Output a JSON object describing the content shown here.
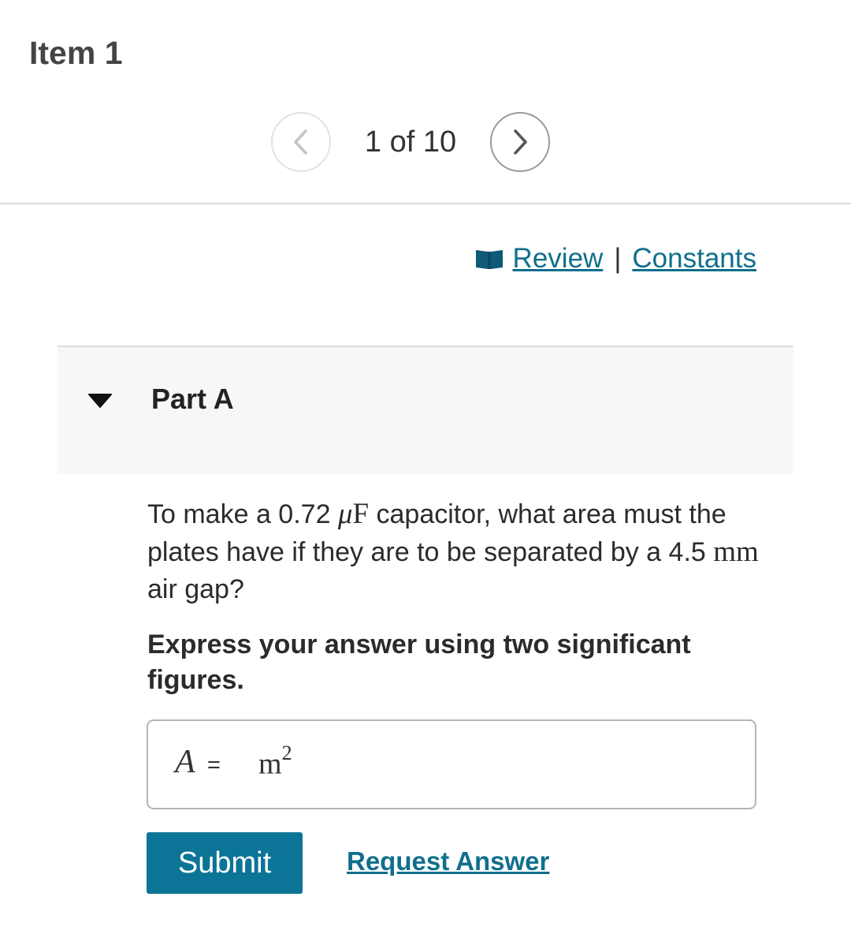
{
  "item": {
    "title": "Item 1"
  },
  "pager": {
    "position_label": "1 of 10",
    "prev_icon": "chevron-left-icon",
    "next_icon": "chevron-right-icon"
  },
  "resources": {
    "icon": "book-icon",
    "review_label": "Review",
    "separator": "|",
    "constants_label": "Constants"
  },
  "part": {
    "caret_icon": "caret-down-icon",
    "title": "Part A"
  },
  "question": {
    "text_1": "To make a 0.72 ",
    "unit_mu": "μ",
    "unit_f": "F",
    "text_2": " capacitor, what area must the plates have if they are to be separated by a 4.5 ",
    "unit_mm": "mm",
    "text_3": " air gap?"
  },
  "instruction": "Express your answer using two significant figures.",
  "answer": {
    "variable": "A",
    "equals": "=",
    "value": "",
    "unit_base": "m",
    "unit_exponent": "2"
  },
  "actions": {
    "submit_label": "Submit",
    "request_answer_label": "Request Answer"
  },
  "colors": {
    "link": "#0f6f8c",
    "submit_bg": "#0b7497",
    "part_header_bg": "#f7f7f7",
    "book_icon": "#0e5a78"
  }
}
